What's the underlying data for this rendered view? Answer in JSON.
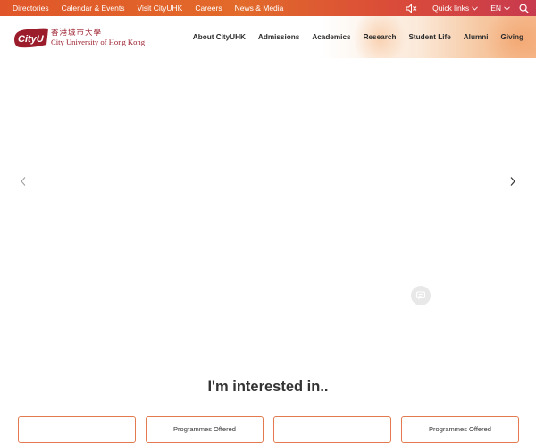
{
  "topbar": {
    "links": [
      {
        "label": "Directories"
      },
      {
        "label": "Calendar & Events"
      },
      {
        "label": "Visit CityUHK"
      },
      {
        "label": "Careers"
      },
      {
        "label": "News & Media"
      }
    ],
    "quick_links_label": "Quick links",
    "language_label": "EN",
    "icons": {
      "mute": "speaker-muted-icon",
      "search": "search-icon"
    }
  },
  "header": {
    "logo": {
      "mark_text": "CityU",
      "chinese_name": "香港城市大學",
      "english_name": "City University of Hong Kong"
    },
    "nav": [
      {
        "label": "About CityUHK"
      },
      {
        "label": "Admissions"
      },
      {
        "label": "Academics"
      },
      {
        "label": "Research"
      },
      {
        "label": "Student Life"
      },
      {
        "label": "Alumni"
      },
      {
        "label": "Giving"
      }
    ]
  },
  "hero": {
    "icons": {
      "prev": "chevron-left-icon",
      "next": "chevron-right-icon",
      "chat": "chat-icon"
    }
  },
  "interested": {
    "title": "I'm interested in..",
    "cards": [
      {
        "label": ""
      },
      {
        "label": "Programmes Offered"
      },
      {
        "label": ""
      },
      {
        "label": "Programmes Offered"
      }
    ]
  },
  "colors": {
    "brand_red": "#9b1d2c",
    "topbar_orange": "#e26a2a",
    "card_border": "#e37a4f"
  }
}
